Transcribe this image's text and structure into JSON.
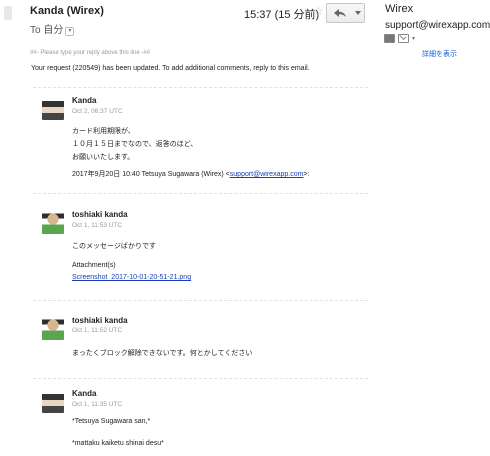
{
  "header": {
    "sender": "Kanda (Wirex)",
    "to": "To 自分",
    "time": "15:37 (15 分前)"
  },
  "body": {
    "reply_marker": "##- Please type your reply above this line -##",
    "request_line": "Your request (220549) has been updated. To add additional comments, reply to this email."
  },
  "messages": [
    {
      "name": "Kanda",
      "date": "Oct 2, 06:37 UTC",
      "lines": [
        "カード利用期限が、",
        "１０月１５日までなので、返答のほど、",
        "お願いいたします。"
      ],
      "quote_prefix": "2017年9月20日 10:40 Tetsuya Sugawara (Wirex) <",
      "quote_email": "support@wirexapp.com",
      "quote_suffix": ">:"
    },
    {
      "name": "toshiaki kanda",
      "date": "Oct 1, 11:53 UTC",
      "lines": [
        "このメッセージばかりです"
      ],
      "attachment_label": "Attachment(s)",
      "attachment_file": "Screenshot_2017-10-01-20-51-21.png"
    },
    {
      "name": "toshiaki kanda",
      "date": "Oct 1, 11:52 UTC",
      "lines": [
        "まったくブロック解除できないです。何とかしてください"
      ]
    },
    {
      "name": "Kanda",
      "date": "Oct 1, 11:35 UTC",
      "lines": [
        "*Tetsuya Sugawara san,*",
        "*mattaku kaiketu shinai desu*"
      ]
    }
  ],
  "contact": {
    "name": "Wirex",
    "email": "support@wirexapp.com",
    "details_link": "詳細を表示"
  }
}
